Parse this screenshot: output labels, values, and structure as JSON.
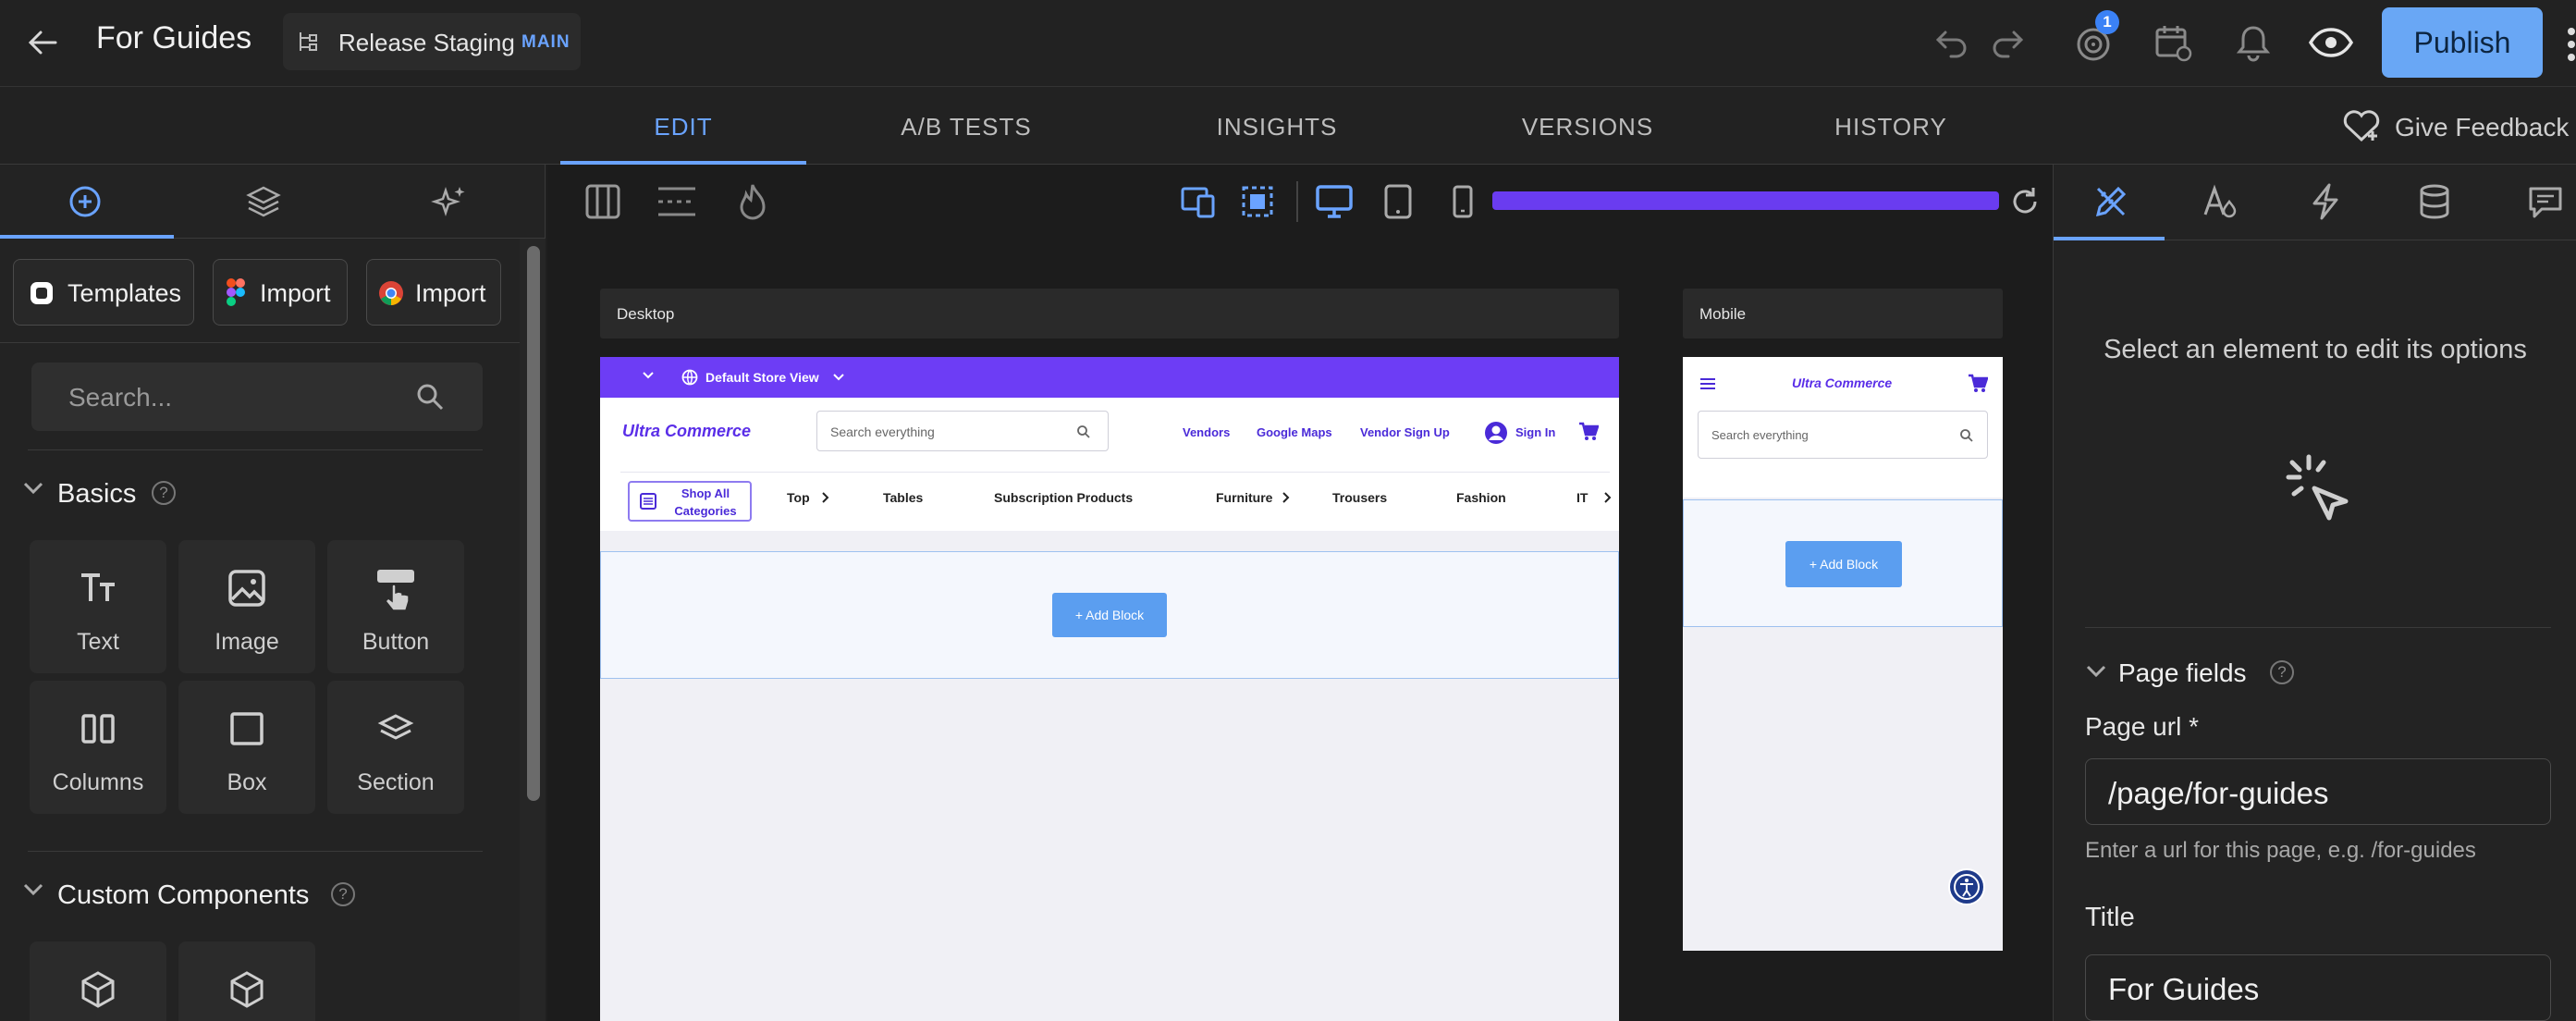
{
  "topbar": {
    "title": "For Guides",
    "branch_name": "Release Staging",
    "branch_tag": "MAIN",
    "notification_count": "1",
    "publish_label": "Publish"
  },
  "tabs": [
    {
      "label": "EDIT",
      "active": true
    },
    {
      "label": "A/B TESTS",
      "active": false
    },
    {
      "label": "INSIGHTS",
      "active": false
    },
    {
      "label": "VERSIONS",
      "active": false
    },
    {
      "label": "HISTORY",
      "active": false
    }
  ],
  "give_feedback": "Give Feedback",
  "left_panel": {
    "buttons": [
      "Templates",
      "Import",
      "Import"
    ],
    "search_placeholder": "Search...",
    "basics_title": "Basics",
    "basics": [
      "Text",
      "Image",
      "Button",
      "Columns",
      "Box",
      "Section"
    ],
    "custom_title": "Custom Components"
  },
  "canvas": {
    "desktop_label": "Desktop",
    "mobile_label": "Mobile",
    "store_view": "Default Store View",
    "logo": "Ultra Commerce",
    "search_placeholder": "Search everything",
    "links": [
      "Vendors",
      "Google Maps",
      "Vendor Sign Up"
    ],
    "sign_in": "Sign In",
    "shop_all": "Shop All Categories",
    "categories": [
      "Top",
      "Tables",
      "Subscription Products",
      "Furniture",
      "Trousers",
      "Fashion",
      "IT"
    ],
    "add_block": "+ Add Block"
  },
  "right_panel": {
    "empty_message": "Select an element to edit its options",
    "page_fields_title": "Page fields",
    "page_url_label": "Page url *",
    "page_url_value": "/page/for-guides",
    "page_url_hint": "Enter a url for this page, e.g. /for-guides",
    "title_label": "Title",
    "title_value": "For Guides"
  },
  "colors": {
    "accent": "#6aa3ff",
    "publish": "#69a7f5",
    "brand_purple": "#6d3df5",
    "background": "#1f1f1f"
  }
}
